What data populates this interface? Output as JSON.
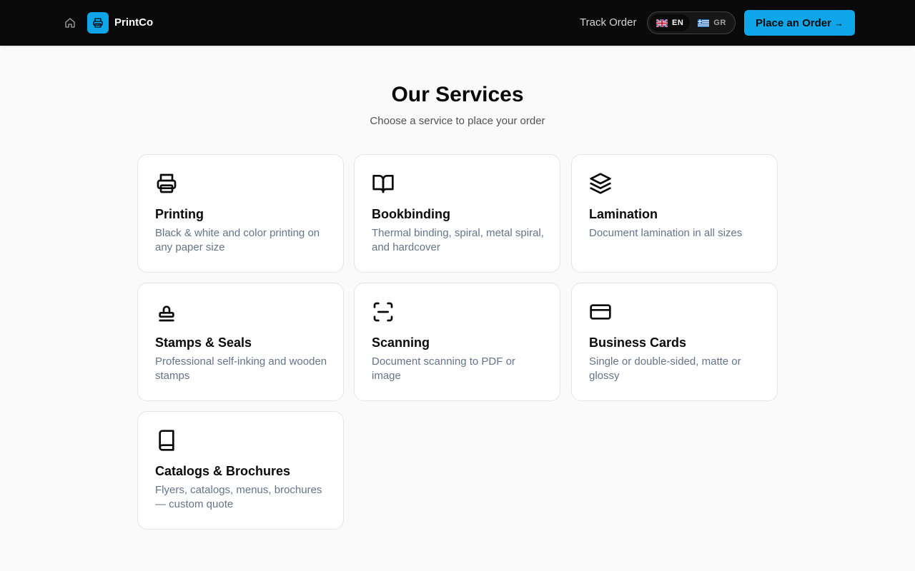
{
  "nav": {
    "brand": "PrintCo",
    "track_order": "Track Order",
    "languages": [
      {
        "code": "EN",
        "flag": "uk-flag",
        "active": true
      },
      {
        "code": "GR",
        "flag": "greece-flag",
        "active": false
      }
    ],
    "order_button": {
      "label": "Place an Order",
      "arrow": "→"
    }
  },
  "colors": {
    "accent": "#0ea5e9",
    "navbar_bg": "#0a0a0a",
    "page_bg": "#fafafa",
    "muted_text": "#64748b"
  },
  "main": {
    "title": "Our Services",
    "subtitle": "Choose a service to place your order",
    "services": [
      {
        "icon": "printer-icon",
        "title": "Printing",
        "description": "Black & white and color printing on any paper size"
      },
      {
        "icon": "open-book-icon",
        "title": "Bookbinding",
        "description": "Thermal binding, spiral, metal spiral, and hardcover"
      },
      {
        "icon": "layers-icon",
        "title": "Lamination",
        "description": "Document lamination in all sizes"
      },
      {
        "icon": "stamp-icon",
        "title": "Stamps & Seals",
        "description": "Professional self-inking and wooden stamps"
      },
      {
        "icon": "scan-icon",
        "title": "Scanning",
        "description": "Document scanning to PDF or image"
      },
      {
        "icon": "card-icon",
        "title": "Business Cards",
        "description": "Single or double-sided, matte or glossy"
      },
      {
        "icon": "book-icon",
        "title": "Catalogs & Brochures",
        "description": "Flyers, catalogs, menus, brochures — custom quote"
      }
    ]
  }
}
